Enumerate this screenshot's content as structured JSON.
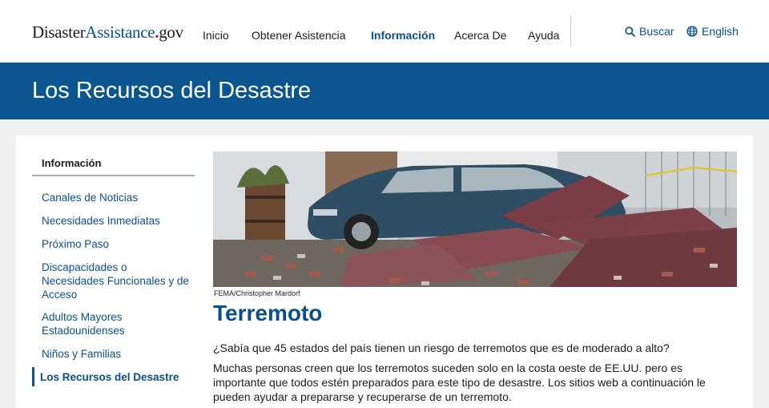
{
  "header": {
    "logo": {
      "part1": "Disaster",
      "part2": "Assistance",
      "dot": ".",
      "part3": "gov"
    },
    "nav": [
      "Inicio",
      "Obtener Asistencia",
      "Información",
      "Acerca De",
      "Ayuda"
    ],
    "active_nav": "Información",
    "search_label": "Buscar",
    "language_label": "English"
  },
  "banner": {
    "title": "Los Recursos del Desastre"
  },
  "sidebar": {
    "heading": "Información",
    "items": [
      "Canales de Noticias",
      "Necesidades Inmediatas",
      "Próximo Paso",
      "Discapacidades o Necesidades Funcionales y de Acceso",
      "Adultos Mayores Estadounidenses",
      "Niños y Familias",
      "Los Recursos del Desastre"
    ],
    "current_item": "Los Recursos del Desastre"
  },
  "article": {
    "image_caption": "FEMA/Christopher Mardorf",
    "title": "Terremoto",
    "paragraph1": "¿Sabía que 45 estados del país tienen un riesgo de terremotos que es de moderado a alto?",
    "paragraph2": "Muchas personas creen que los terremotos suceden solo en la costa oeste de EE.UU. pero es importante que todos estén preparados para este tipo de desastre. Los sitios web a continuación le pueden ayudar a prepararse y recuperarse de un terremoto."
  },
  "colors": {
    "brand_blue": "#0b5591",
    "link_blue": "#0b4f8a",
    "logo_dot_red": "#c8102e"
  },
  "icons": [
    "search-icon",
    "globe-icon"
  ]
}
